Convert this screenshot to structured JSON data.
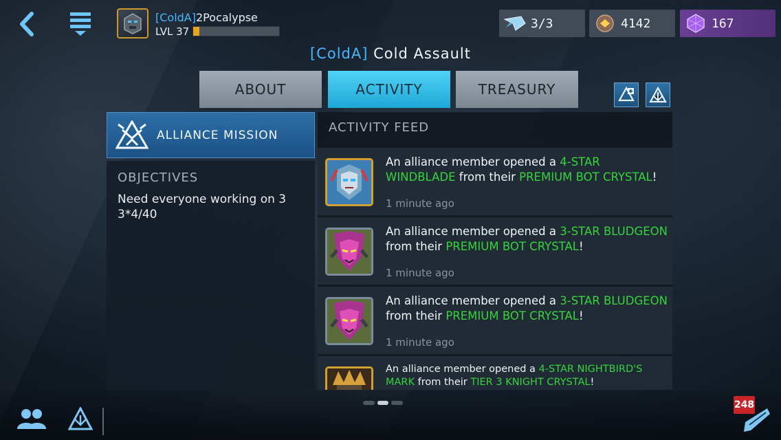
{
  "player": {
    "tag": "[ColdA]",
    "name": "2Pocalypse",
    "level": "LVL 37",
    "xp_fraction": 0.07
  },
  "resources": {
    "ships": "3/3",
    "ore": "4142",
    "gems": "167"
  },
  "alliance": {
    "tag": "[ColdA]",
    "name": "Cold Assault"
  },
  "tabs": [
    {
      "label": "ABOUT"
    },
    {
      "label": "ACTIVITY"
    },
    {
      "label": "TREASURY"
    }
  ],
  "left_panel": {
    "mission_label": "ALLIANCE MISSION",
    "objectives_title": "OBJECTIVES",
    "objectives_text": "Need everyone working on 3 3*4/40"
  },
  "feed": {
    "title": "ACTIVITY FEED",
    "items": [
      {
        "prefix": "An alliance member opened a ",
        "bot": "4-STAR WINDBLADE",
        "middle": " from their ",
        "crystal": "PREMIUM BOT CRYSTAL",
        "suffix": "!",
        "time": "1 minute ago"
      },
      {
        "prefix": "An alliance member opened a ",
        "bot": "3-STAR BLUDGEON",
        "middle": " from their ",
        "crystal": "PREMIUM BOT CRYSTAL",
        "suffix": "!",
        "time": "1 minute ago"
      },
      {
        "prefix": "An alliance member opened a ",
        "bot": "3-STAR BLUDGEON",
        "middle": " from their ",
        "crystal": "PREMIUM BOT CRYSTAL",
        "suffix": "!",
        "time": "1 minute ago"
      },
      {
        "prefix": "An alliance member opened a ",
        "bot": "4-STAR NIGHTBIRD'S MARK",
        "middle": " from their ",
        "crystal": "TIER 3 KNIGHT CRYSTAL",
        "suffix": "!",
        "time": ""
      }
    ]
  },
  "chat": {
    "badge": "248"
  },
  "colors": {
    "accent": "#46b6ff",
    "highlight": "#36d43c",
    "active_tab": "#2fc0ec",
    "badge": "#c8252a"
  },
  "icons": {
    "back": "chevron-left-icon",
    "menu": "menu-icon",
    "ships": "ship-icon",
    "ore": "ore-icon",
    "gems": "gem-icon",
    "mission": "alliance-emblem-icon",
    "friends": "friends-icon",
    "alliance": "alliance-icon",
    "chat": "chat-icon"
  }
}
